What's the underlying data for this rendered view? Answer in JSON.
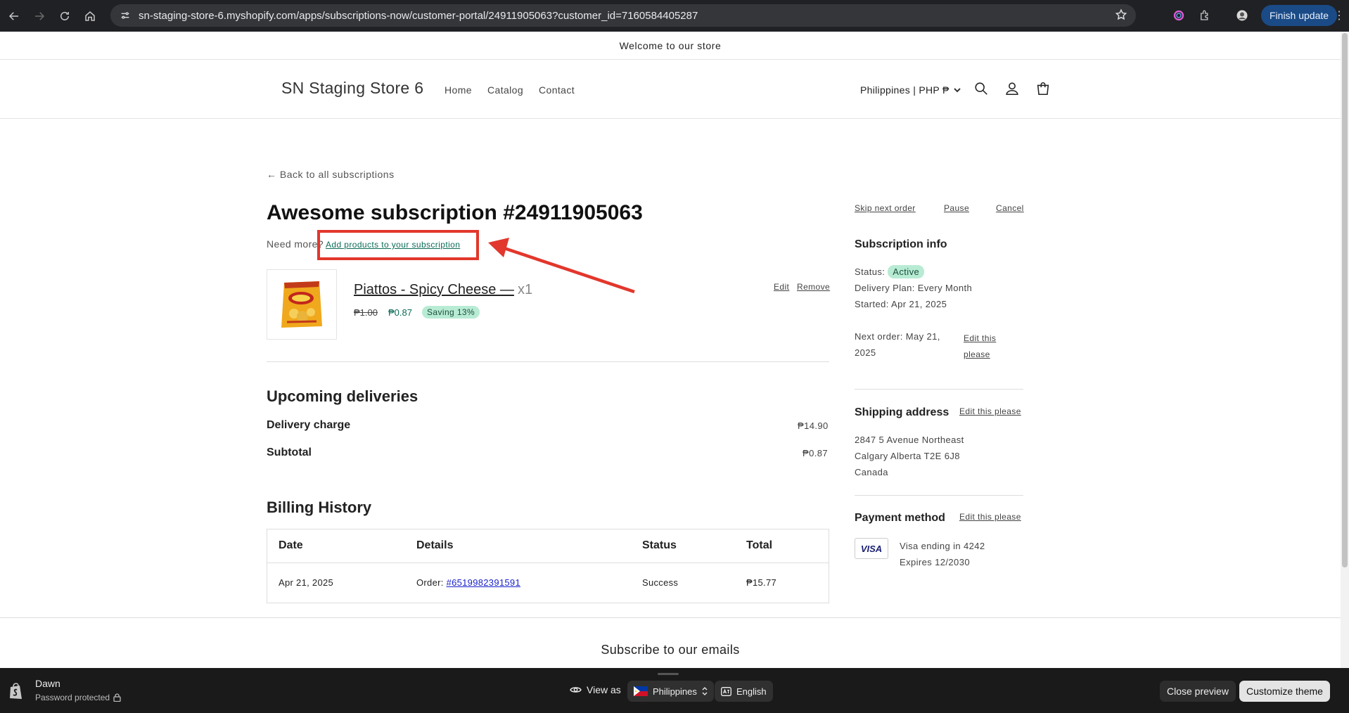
{
  "browser": {
    "url": "sn-staging-store-6.myshopify.com/apps/subscriptions-now/customer-portal/24911905063?customer_id=7160584405287",
    "finish_update": "Finish update"
  },
  "store": {
    "announcement": "Welcome to our store",
    "name": "SN Staging Store 6",
    "nav": [
      "Home",
      "Catalog",
      "Contact"
    ],
    "locale": "Philippines | PHP ₱"
  },
  "subscription": {
    "back_link": "← Back to all subscriptions",
    "title": "Awesome subscription #24911905063",
    "need_more": "Need more?",
    "add_products": "Add products to your subscription",
    "actions": {
      "skip": "Skip next order",
      "pause": "Pause",
      "cancel": "Cancel"
    },
    "product": {
      "title": "Piattos - Spicy Cheese —",
      "qty": "x1",
      "price_old": "₱1.00",
      "price_new": "₱0.87",
      "saving": "Saving 13%",
      "edit": "Edit",
      "remove": "Remove"
    },
    "upcoming": {
      "heading": "Upcoming deliveries",
      "delivery_label": "Delivery charge",
      "delivery_value": "₱14.90",
      "subtotal_label": "Subtotal",
      "subtotal_value": "₱0.87"
    },
    "billing": {
      "heading": "Billing History",
      "columns": [
        "Date",
        "Details",
        "Status",
        "Total"
      ],
      "rows": [
        {
          "date": "Apr 21, 2025",
          "details_prefix": "Order: ",
          "order": "#6519982391591",
          "status": "Success",
          "total": "₱15.77"
        }
      ]
    }
  },
  "sidebar": {
    "info_heading": "Subscription info",
    "status_label": "Status:",
    "status_value": "Active",
    "delivery_plan": "Delivery Plan: Every Month",
    "started": "Started: Apr 21, 2025",
    "next_order_line1": "Next order: May 21,",
    "next_order_line2": "2025",
    "edit_next_line1": "Edit this",
    "edit_next_line2": "please",
    "shipping_heading": "Shipping address",
    "edit_shipping": "Edit this please",
    "address": [
      "2847 5 Avenue Northeast",
      "Calgary Alberta T2E 6J8",
      "Canada"
    ],
    "payment_heading": "Payment method",
    "edit_payment": "Edit this please",
    "card_brand": "VISA",
    "card_line1": "Visa ending in 4242",
    "card_line2": "Expires 12/2030"
  },
  "footer": {
    "subscribe": "Subscribe to our emails"
  },
  "preview_bar": {
    "theme": "Dawn",
    "password": "Password protected",
    "view_as": "View as",
    "country": "Philippines",
    "language": "English",
    "close": "Close preview",
    "customize": "Customize theme"
  },
  "colors": {
    "accent": "#0c6b57",
    "highlight": "#e2372c",
    "pill_bg": "#b8ebd4"
  }
}
